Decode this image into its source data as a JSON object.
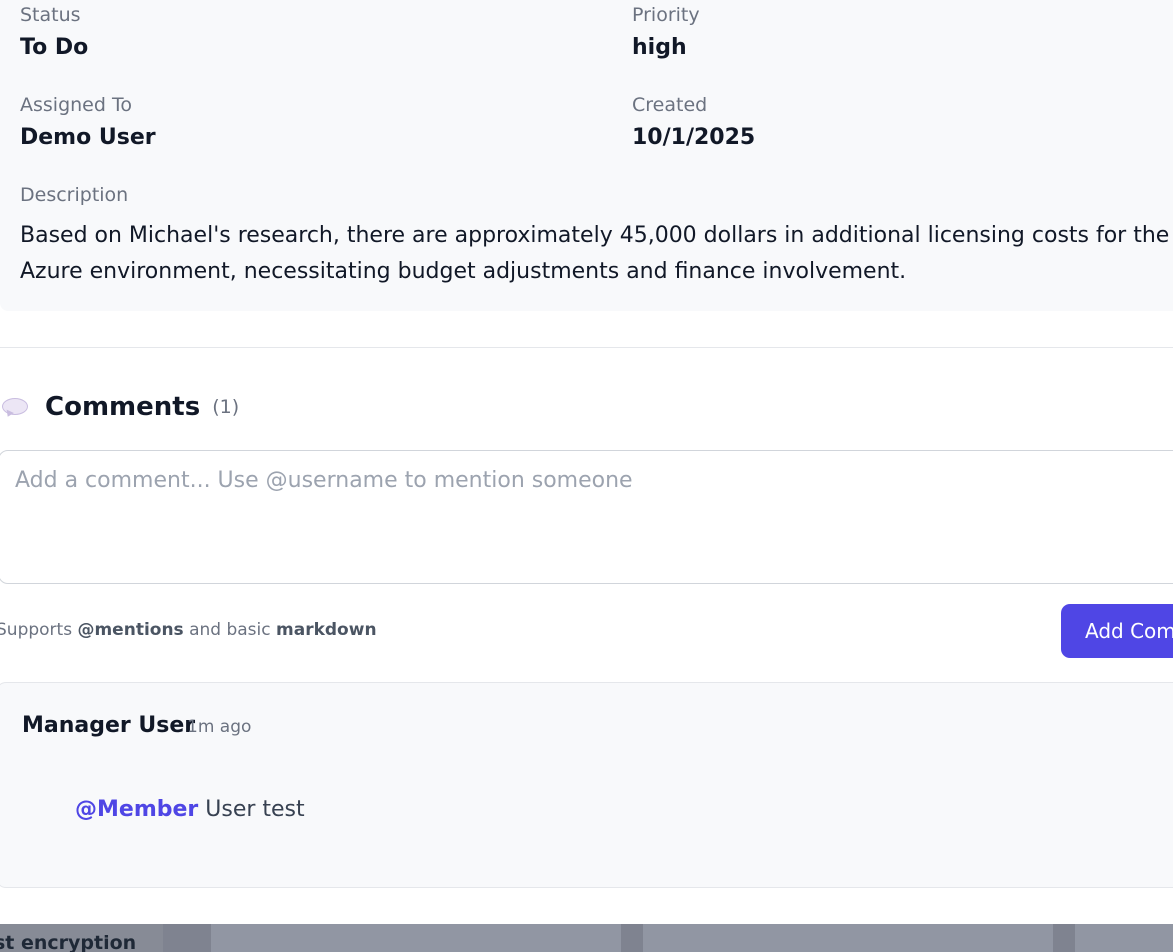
{
  "details": {
    "status_label": "Status",
    "status_value": "To Do",
    "priority_label": "Priority",
    "priority_value": "high",
    "assigned_label": "Assigned To",
    "assigned_value": "Demo User",
    "created_label": "Created",
    "created_value": "10/1/2025",
    "description_label": "Description",
    "description_text": "Based on Michael's research, there are approximately 45,000 dollars in additional licensing costs for the Azure environment, necessitating budget adjustments and finance involvement."
  },
  "comments": {
    "title": "Comments",
    "count": "(1)",
    "input_placeholder": "Add a comment... Use @username to mention someone",
    "hint_prefix": "Supports ",
    "hint_mentions": "@mentions",
    "hint_middle": " and basic ",
    "hint_markdown": "markdown",
    "add_button_label": "Add Comment",
    "items": [
      {
        "author": "Manager User",
        "time": "1m ago",
        "mention": "@Member",
        "text": " User test"
      }
    ]
  },
  "background": {
    "partial_text": "st encryption"
  },
  "colors": {
    "accent": "#4f46e5",
    "panel_bg": "#f8f9fb",
    "muted_text": "#6b7280"
  }
}
